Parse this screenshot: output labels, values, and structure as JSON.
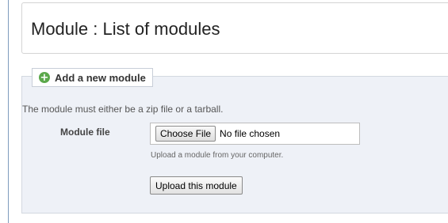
{
  "header": {
    "title": "Module : List of modules"
  },
  "add_module": {
    "legend": "Add a new module",
    "legend_icon": "add-circle-icon",
    "accent_color": "#5ba84b",
    "note": "The module must either be a zip file or a tarball.",
    "field_label": "Module file",
    "choose_button_label": "Choose File",
    "file_status": "No file chosen",
    "help_text": "Upload a module from your computer.",
    "upload_button_label": "Upload this module"
  }
}
